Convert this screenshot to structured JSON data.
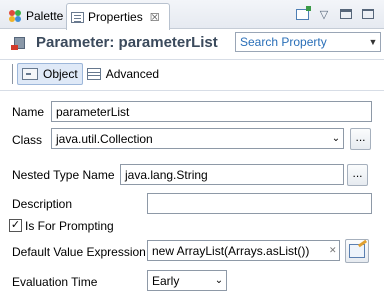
{
  "tabs": [
    {
      "label": "Palette",
      "icon": "palette-icon"
    },
    {
      "label": "Properties",
      "icon": "properties-icon",
      "close": "☒"
    }
  ],
  "header": {
    "title": "Parameter: parameterList",
    "search_value": "Search Property"
  },
  "subtabs": {
    "object_label": "Object",
    "advanced_label": "Advanced"
  },
  "form": {
    "name_label": "Name",
    "name_value": "parameterList",
    "class_label": "Class",
    "class_value": "java.util.Collection",
    "class_button": "...",
    "nested_label": "Nested Type Name",
    "nested_value": "java.lang.String",
    "nested_button": "...",
    "description_label": "Description",
    "description_value": "",
    "prompting_label": "Is For Prompting",
    "prompting_checked": "✓",
    "default_label": "Default Value Expression",
    "default_value": "new ArrayList(Arrays.asList())",
    "eval_label": "Evaluation Time",
    "eval_value": "Early"
  }
}
